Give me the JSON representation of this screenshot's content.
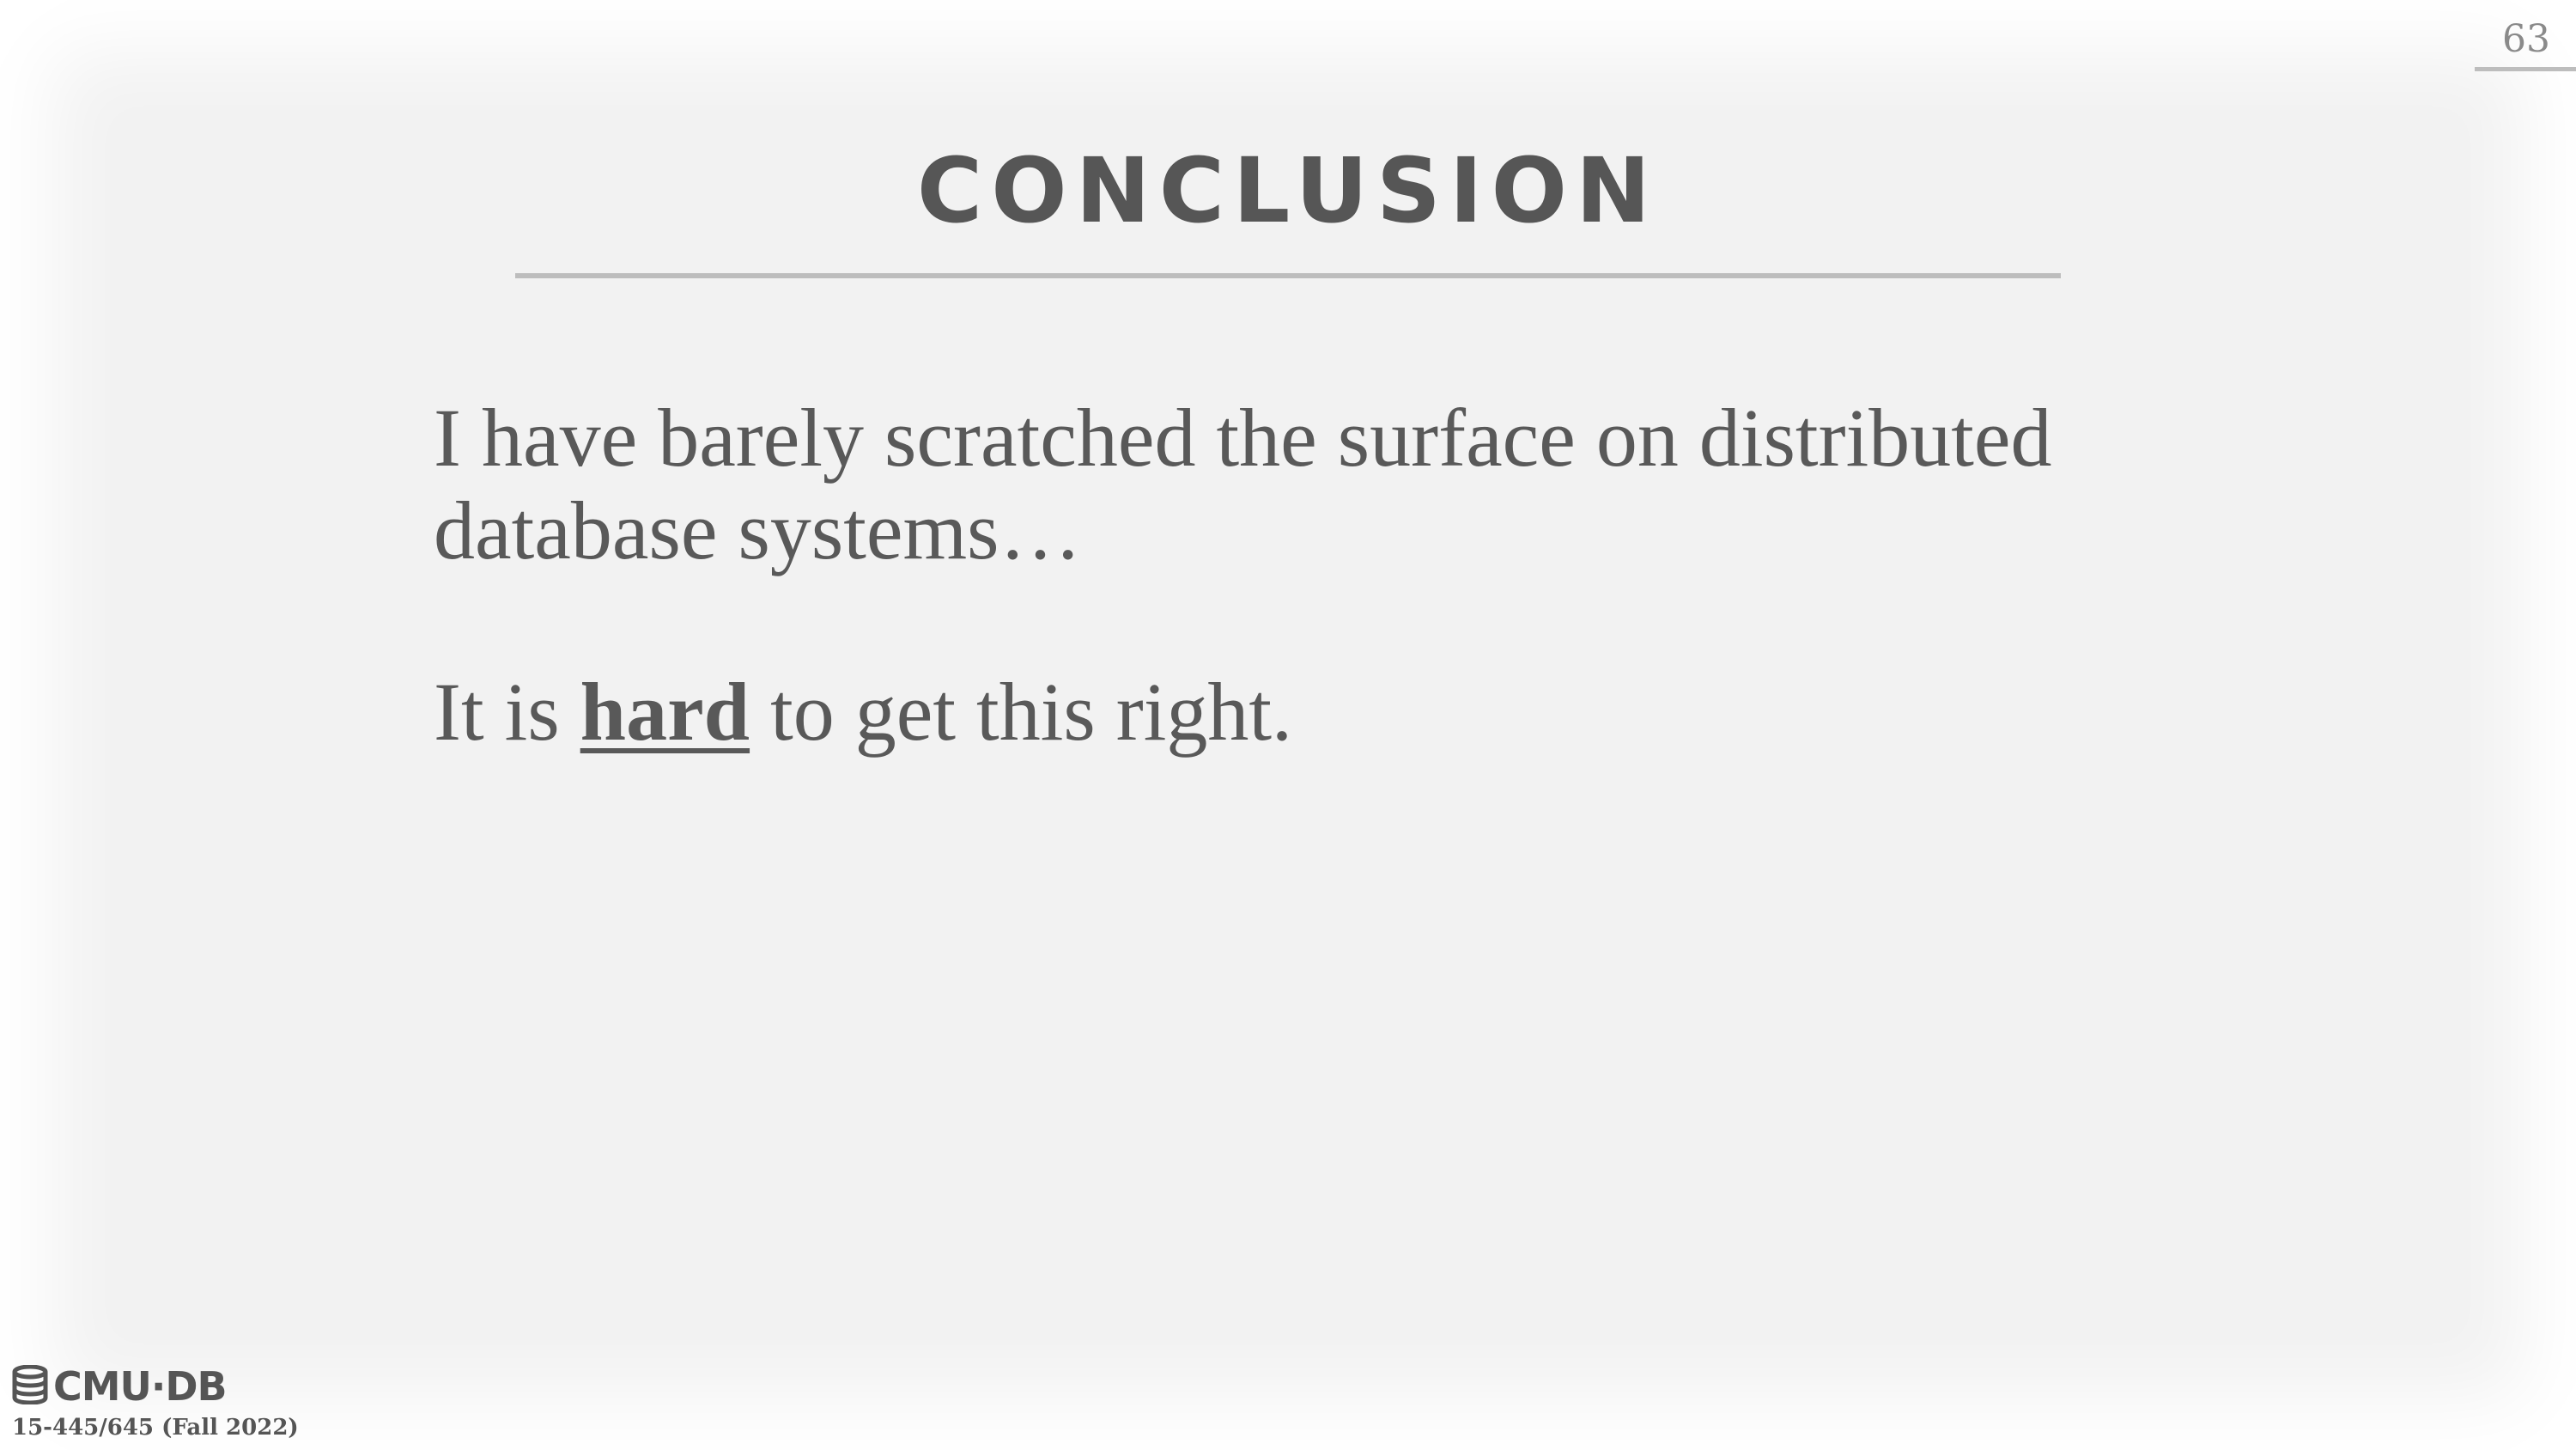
{
  "slide": {
    "page_number": "63",
    "title": "CONCLUSION",
    "paragraph1": "I have barely scratched the surface on distributed database systems…",
    "paragraph2": {
      "before": "It is ",
      "emphasis": "hard",
      "after": " to get this right."
    }
  },
  "footer": {
    "logo_text": "CMU·DB",
    "logo_icon": "database-icon",
    "course": "15-445/645 (Fall 2022)"
  },
  "colors": {
    "background": "#f2f2f2",
    "text": "#595959",
    "rule": "#bdbdbd"
  }
}
